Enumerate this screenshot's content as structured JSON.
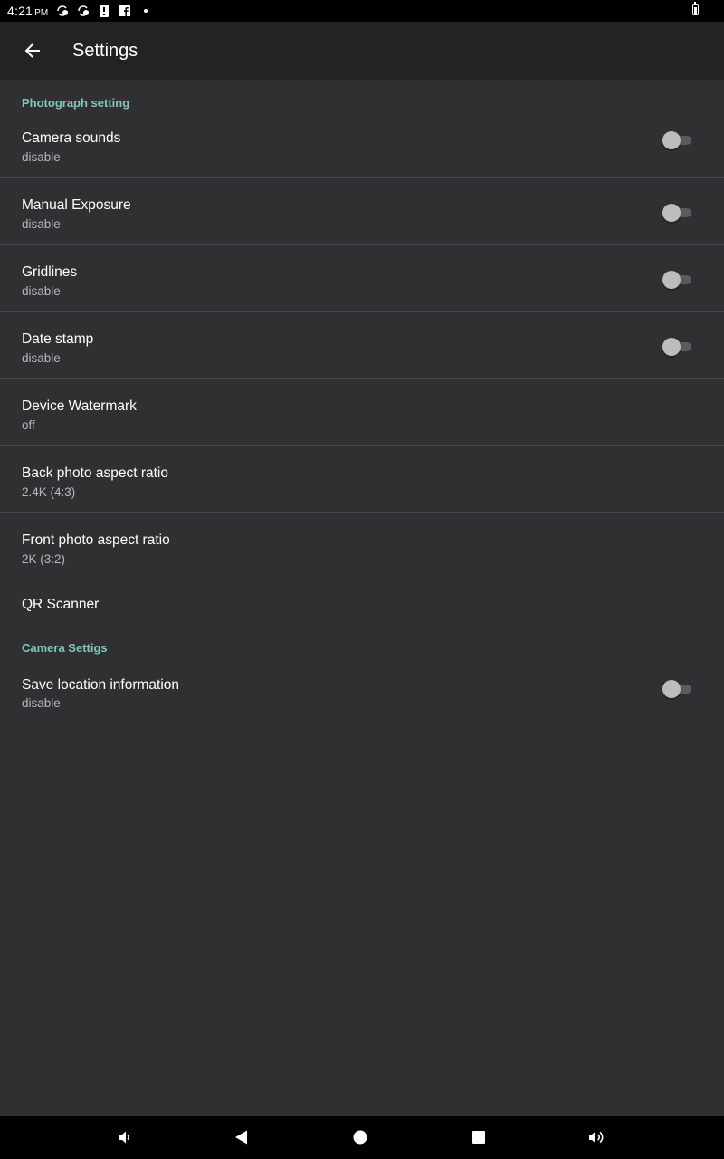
{
  "status_bar": {
    "time": "4:21",
    "ampm": "PM",
    "icons": [
      "sync-check-icon",
      "sync-check-icon",
      "alert-icon",
      "facebook-icon",
      "dot-icon",
      "battery-icon"
    ]
  },
  "app_bar": {
    "title": "Settings",
    "back_icon": "arrow-back-icon"
  },
  "sections": [
    {
      "header": "Photograph setting",
      "items": [
        {
          "title": "Camera sounds",
          "summary": "disable",
          "toggle": false
        },
        {
          "title": "Manual Exposure",
          "summary": "disable",
          "toggle": false
        },
        {
          "title": "Gridlines",
          "summary": "disable",
          "toggle": false
        },
        {
          "title": "Date stamp",
          "summary": "disable",
          "toggle": false
        },
        {
          "title": "Device Watermark",
          "summary": "off"
        },
        {
          "title": "Back photo aspect ratio",
          "summary": "2.4K (4:3)"
        },
        {
          "title": "Front photo aspect ratio",
          "summary": "2K (3:2)"
        },
        {
          "title": "QR Scanner"
        }
      ]
    },
    {
      "header": "Camera Settigs",
      "items": [
        {
          "title": "Save location information",
          "summary": "disable",
          "toggle": false
        }
      ]
    }
  ],
  "nav_bar": {
    "icons": [
      "volume-down-icon",
      "back-triangle-icon",
      "home-circle-icon",
      "recents-square-icon",
      "volume-up-icon"
    ]
  },
  "colors": {
    "background": "#303033",
    "app_bar": "#232325",
    "accent_header": "#7fc8b8",
    "divider": "#454549"
  }
}
